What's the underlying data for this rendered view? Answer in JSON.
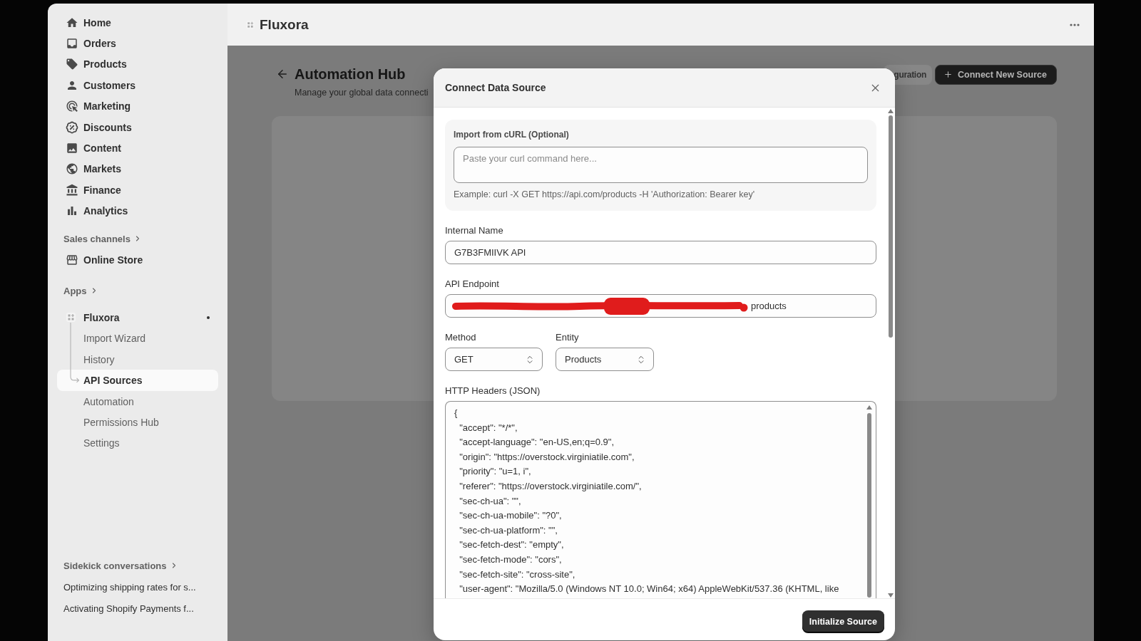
{
  "sidebar": {
    "nav": [
      {
        "label": "Home",
        "selected": false
      },
      {
        "label": "Orders",
        "selected": false
      },
      {
        "label": "Products",
        "selected": false
      },
      {
        "label": "Customers",
        "selected": false
      },
      {
        "label": "Marketing",
        "selected": false
      },
      {
        "label": "Discounts",
        "selected": false
      },
      {
        "label": "Content",
        "selected": false
      },
      {
        "label": "Markets",
        "selected": false
      },
      {
        "label": "Finance",
        "selected": false
      },
      {
        "label": "Analytics",
        "selected": false
      }
    ],
    "sales_channels": {
      "heading": "Sales channels",
      "items": [
        {
          "label": "Online Store",
          "selected": false
        }
      ]
    },
    "apps": {
      "heading": "Apps",
      "app": {
        "label": "Fluxora",
        "children": [
          {
            "label": "Import Wizard",
            "selected": false
          },
          {
            "label": "History",
            "selected": false
          },
          {
            "label": "API Sources",
            "selected": true
          },
          {
            "label": "Automation",
            "selected": false
          },
          {
            "label": "Permissions Hub",
            "selected": false
          },
          {
            "label": "Settings",
            "selected": false
          }
        ]
      }
    },
    "sidekick": {
      "heading": "Sidekick conversations",
      "items": [
        {
          "label": "Optimizing shipping rates for s..."
        },
        {
          "label": "Activating Shopify Payments f..."
        }
      ]
    }
  },
  "topbar": {
    "title": "Fluxora"
  },
  "page": {
    "title": "Automation Hub",
    "subtitle": "Manage your global data connecti",
    "buttons": [
      {
        "label": "guration",
        "kind": "secondary"
      },
      {
        "label": "Connect New Source",
        "kind": "primary"
      }
    ]
  },
  "modal": {
    "title": "Connect Data Source",
    "curl_import": {
      "label": "Import from cURL (Optional)",
      "placeholder": "Paste your curl command here...",
      "hint": "Example: curl -X GET https://api.com/products -H 'Authorization: Bearer key'"
    },
    "fields": [
      {
        "label": "Internal Name",
        "value": "G7B3FMIIVK API",
        "redacted": false
      },
      {
        "label": "API Endpoint",
        "value": "products",
        "redacted": true
      }
    ],
    "selects": [
      {
        "label": "Method",
        "value": "GET"
      },
      {
        "label": "Entity",
        "value": "Products"
      }
    ],
    "headers": {
      "label": "HTTP Headers (JSON)",
      "value": "{\n  \"accept\": \"*/*\",\n  \"accept-language\": \"en-US,en;q=0.9\",\n  \"origin\": \"https://overstock.virginiatile.com\",\n  \"priority\": \"u=1, i\",\n  \"referer\": \"https://overstock.virginiatile.com/\",\n  \"sec-ch-ua\": \"\",\n  \"sec-ch-ua-mobile\": \"?0\",\n  \"sec-ch-ua-platform\": \"\",\n  \"sec-fetch-dest\": \"empty\",\n  \"sec-fetch-mode\": \"cors\",\n  \"sec-fetch-site\": \"cross-site\",\n  \"user-agent\": \"Mozilla/5.0 (Windows NT 10.0; Win64; x64) AppleWebKit/537.36 (KHTML, like"
    },
    "submit": "Initialize Source"
  }
}
